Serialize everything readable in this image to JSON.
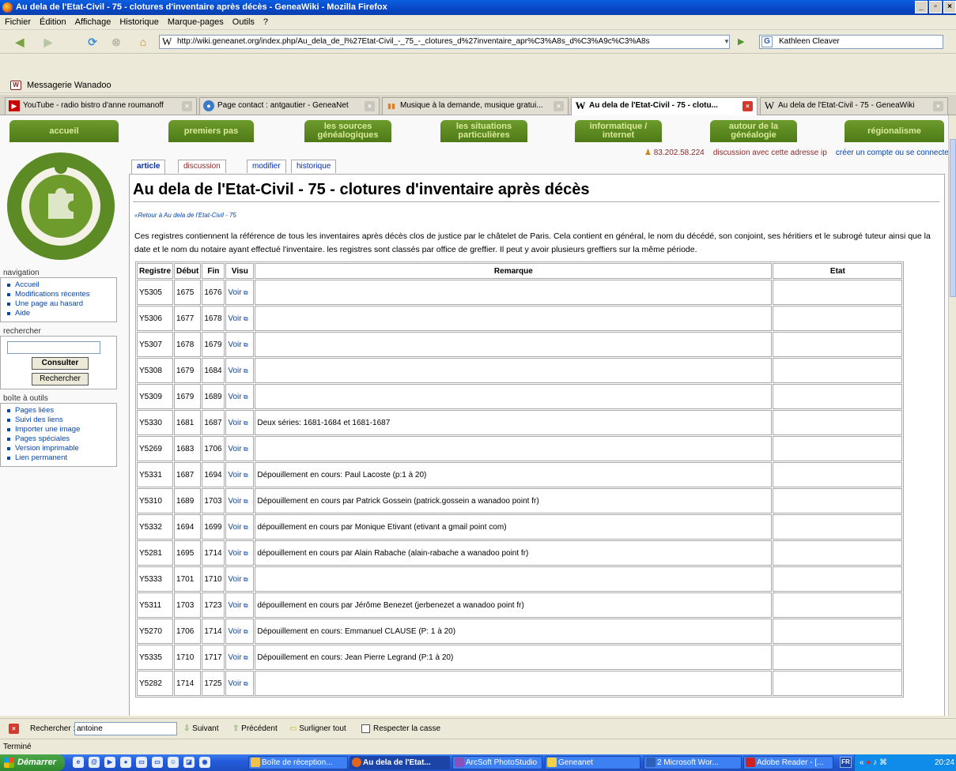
{
  "window": {
    "title": "Au dela de l'Etat-Civil - 75 - clotures d'inventaire après décès - GeneaWiki - Mozilla Firefox"
  },
  "menu": [
    "Fichier",
    "Édition",
    "Affichage",
    "Historique",
    "Marque-pages",
    "Outils",
    "?"
  ],
  "navbar": {
    "url": "http://wiki.geneanet.org/index.php/Au_dela_de_l%27Etat-Civil_-_75_-_clotures_d%27inventaire_apr%C3%A8s_d%C3%A9c%C3%A8s",
    "search_value": "Kathleen Cleaver"
  },
  "bookmarks": {
    "item": "Messagerie Wanadoo"
  },
  "tabs": [
    {
      "label": "YouTube - radio bistro d'anne roumanoff",
      "active": false
    },
    {
      "label": "Page contact : antgautier - GeneaNet",
      "active": false
    },
    {
      "label": "Musique à la demande, musique gratui...",
      "active": false
    },
    {
      "label": "Au dela de l'Etat-Civil - 75 - clotu...",
      "active": true
    },
    {
      "label": "Au dela de l'Etat-Civil - 75 - GeneaWiki",
      "active": false
    }
  ],
  "site_nav": [
    "accueil",
    "premiers pas",
    "les sources\ngénéalogiques",
    "les situations\nparticulières",
    "informatique /\ninternet",
    "autour de la\ngénéalogie",
    "régionalisme"
  ],
  "user": {
    "ip": "83.202.58.224",
    "discussion": "discussion avec cette adresse ip",
    "login": "créer un compte ou se connecter"
  },
  "page_tabs": [
    "article",
    "discussion",
    "modifier",
    "historique"
  ],
  "page": {
    "title": "Au dela de l'Etat-Civil - 75 - clotures d'inventaire après décès",
    "backlink": "«Retour à Au dela de l'Etat-Civil - 75",
    "intro": "Ces registres contiennent la référence de tous les inventaires après décès clos de justice par le châtelet de Paris. Cela contient en général, le nom du décédé, son conjoint, ses héritiers et le subrogé tuteur ainsi que la date et le nom du notaire ayant effectué l'inventaire. les registres sont classés par office de greffier. Il peut y avoir plusieurs greffiers sur la même période."
  },
  "sidebar": {
    "navigation_title": "navigation",
    "navigation": [
      "Accueil",
      "Modifications récentes",
      "Une page au hasard",
      "Aide"
    ],
    "search_title": "rechercher",
    "consult_btn": "Consulter",
    "search_btn": "Rechercher",
    "tools_title": "boîte à outils",
    "tools": [
      "Pages liées",
      "Suivi des liens",
      "Importer une image",
      "Pages spéciales",
      "Version imprimable",
      "Lien permanent"
    ]
  },
  "table": {
    "headers": [
      "Registre",
      "Début",
      "Fin",
      "Visu",
      "Remarque",
      "Etat"
    ],
    "voir": "Voir",
    "rows": [
      [
        "Y5305",
        "1675",
        "1676",
        ""
      ],
      [
        "Y5306",
        "1677",
        "1678",
        ""
      ],
      [
        "Y5307",
        "1678",
        "1679",
        ""
      ],
      [
        "Y5308",
        "1679",
        "1684",
        ""
      ],
      [
        "Y5309",
        "1679",
        "1689",
        ""
      ],
      [
        "Y5330",
        "1681",
        "1687",
        "Deux séries: 1681-1684 et 1681-1687"
      ],
      [
        "Y5269",
        "1683",
        "1706",
        ""
      ],
      [
        "Y5331",
        "1687",
        "1694",
        "Dépouillement en cours: Paul Lacoste (p:1 à 20)"
      ],
      [
        "Y5310",
        "1689",
        "1703",
        "Dépouillement en cours par Patrick Gossein (patrick.gossein a wanadoo point fr)"
      ],
      [
        "Y5332",
        "1694",
        "1699",
        "dépouillement en cours par Monique Etivant (etivant a gmail point com)"
      ],
      [
        "Y5281",
        "1695",
        "1714",
        "dépouillement en cours par Alain Rabache (alain-rabache a wanadoo point fr)"
      ],
      [
        "Y5333",
        "1701",
        "1710",
        ""
      ],
      [
        "Y5311",
        "1703",
        "1723",
        "dépouillement en cours par Jérôme Benezet (jerbenezet a wanadoo point fr)"
      ],
      [
        "Y5270",
        "1706",
        "1714",
        "Dépouillement en cours: Emmanuel CLAUSE (P: 1 à 20)"
      ],
      [
        "Y5335",
        "1710",
        "1717",
        "Dépouillement en cours: Jean Pierre Legrand (P:1 à 20)"
      ],
      [
        "Y5282",
        "1714",
        "1725",
        ""
      ]
    ]
  },
  "findbar": {
    "label": "Rechercher :",
    "value": "antoine",
    "next": "Suivant",
    "prev": "Précédent",
    "highlight": "Surligner tout",
    "matchcase": "Respecter la casse"
  },
  "status": "Terminé",
  "taskbar": {
    "start": "Démarrer",
    "tasks": [
      "Boîte de réception...",
      "Au dela de l'Etat...",
      "ArcSoft PhotoStudio",
      "Geneanet",
      "2 Microsoft Wor...",
      "Adobe Reader - [..."
    ],
    "lang": "FR",
    "clock": "20:24"
  }
}
